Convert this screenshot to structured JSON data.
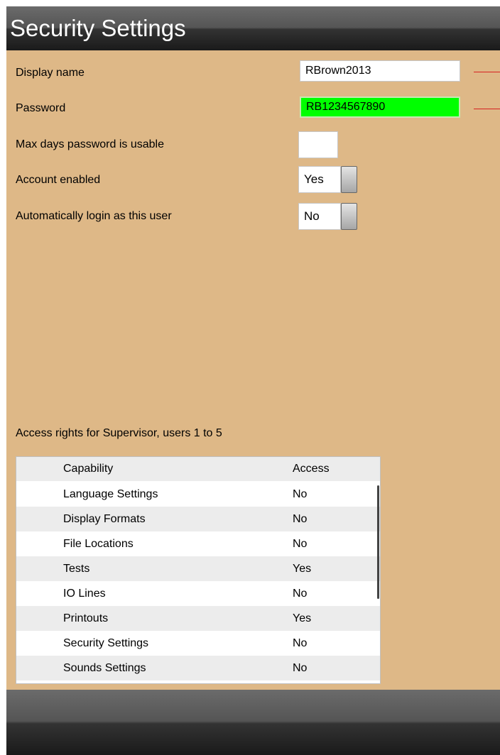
{
  "header": {
    "title": "Security Settings"
  },
  "form": {
    "display_name": {
      "label": "Display name",
      "value": "RBrown2013"
    },
    "password": {
      "label": "Password",
      "value": "RB1234567890",
      "highlight_color": "#00ff00"
    },
    "max_days": {
      "label": "Max days password is usable",
      "value": ""
    },
    "account_enabled": {
      "label": "Account enabled",
      "value": "Yes"
    },
    "auto_login": {
      "label": "Automatically login as this user",
      "value": "No"
    }
  },
  "access": {
    "caption": "Access rights for Supervisor, users 1 to 5",
    "columns": {
      "capability": "Capability",
      "access": "Access"
    },
    "rows": [
      {
        "capability": "Language Settings",
        "access": "No"
      },
      {
        "capability": "Display Formats",
        "access": "No"
      },
      {
        "capability": "File Locations",
        "access": "No"
      },
      {
        "capability": "Tests",
        "access": "Yes"
      },
      {
        "capability": "IO Lines",
        "access": "No"
      },
      {
        "capability": "Printouts",
        "access": "Yes"
      },
      {
        "capability": "Security Settings",
        "access": "No"
      },
      {
        "capability": "Sounds Settings",
        "access": "No"
      }
    ]
  },
  "colors": {
    "background": "#deb887",
    "bar": "#333333",
    "accent_red": "#d62020"
  }
}
